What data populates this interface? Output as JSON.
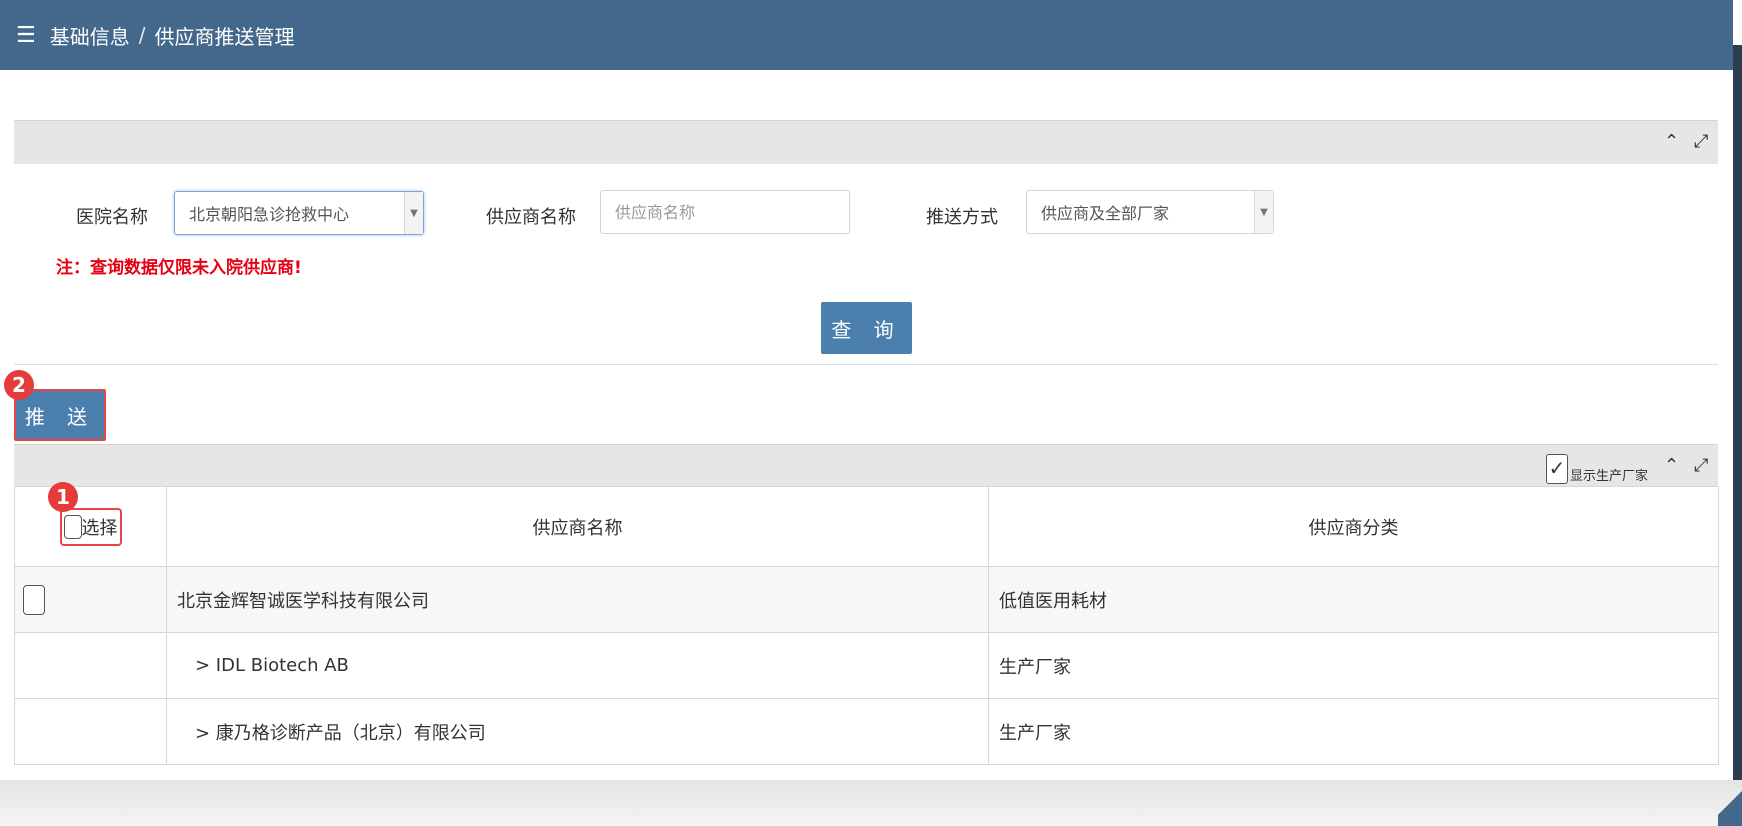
{
  "header": {
    "menu_icon": "hamburger-icon",
    "breadcrumb_root": "基础信息",
    "breadcrumb_sep": "/",
    "breadcrumb_current": "供应商推送管理"
  },
  "search": {
    "hospital_label": "医院名称",
    "hospital_value": "北京朝阳急诊抢救中心",
    "supplier_label": "供应商名称",
    "supplier_placeholder": "供应商名称",
    "push_mode_label": "推送方式",
    "push_mode_value": "供应商及全部厂家",
    "note": "注：查询数据仅限未入院供应商!",
    "query_button": "查 询"
  },
  "push_button": "推 送",
  "annotations": {
    "badge_1": "1",
    "badge_2": "2"
  },
  "grid_toolbar": {
    "show_manufacturer_label": "显示生产厂家",
    "show_manufacturer_checked": true
  },
  "table": {
    "columns": [
      "选择",
      "供应商名称",
      "供应商分类"
    ],
    "rows": [
      {
        "name": "北京金辉智诚医学科技有限公司",
        "category": "低值医用耗材"
      },
      {
        "name": "> IDL Biotech AB",
        "category": "生产厂家"
      },
      {
        "name": "> 康乃格诊断产品（北京）有限公司",
        "category": "生产厂家"
      }
    ]
  },
  "colors": {
    "header_bg": "#44688c",
    "button_bg": "#4a7fae",
    "highlight_red": "#e84646",
    "note_red": "#e60012"
  }
}
